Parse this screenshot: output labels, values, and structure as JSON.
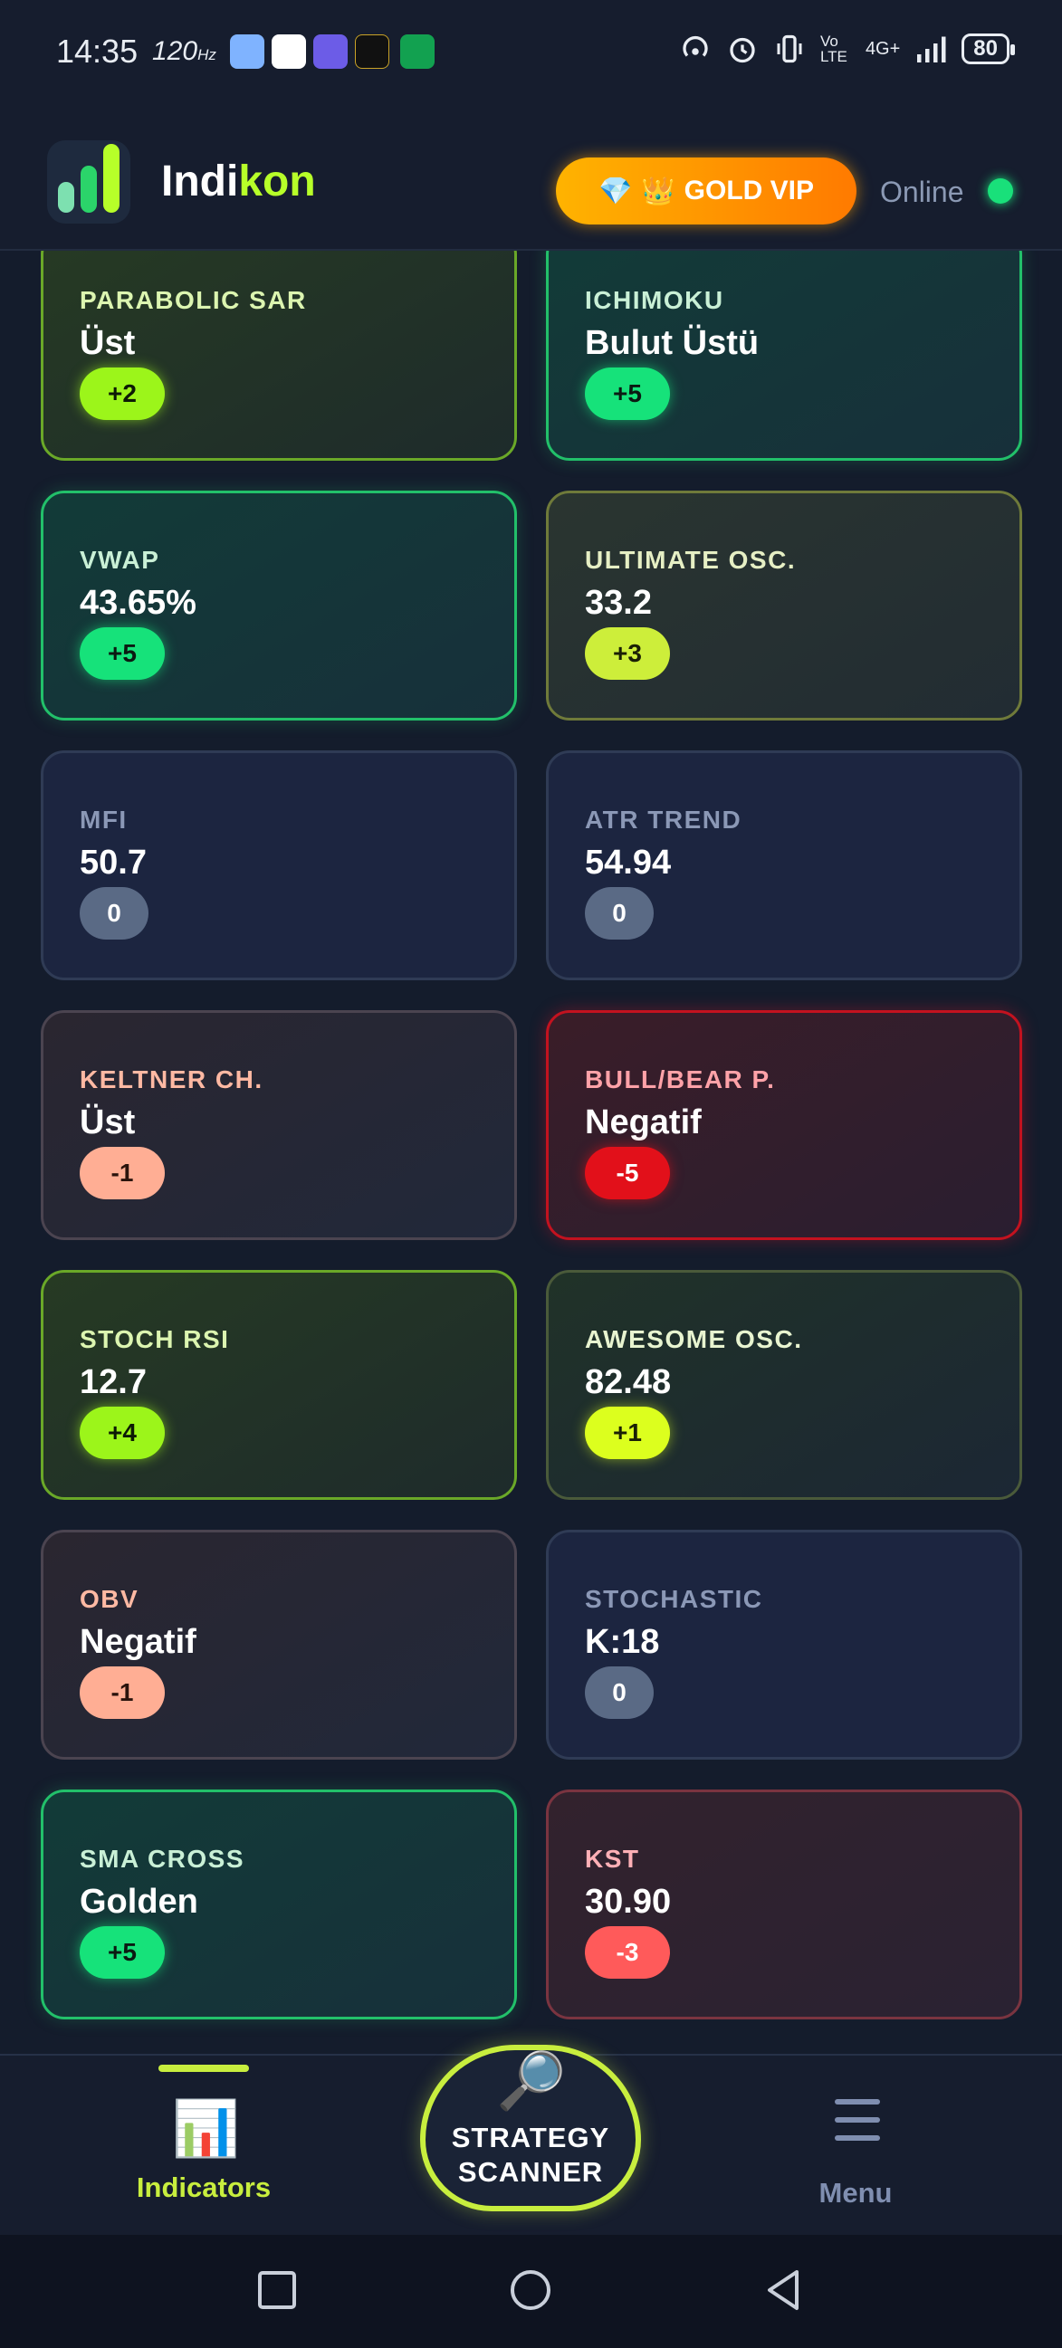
{
  "status_bar": {
    "time": "14:35",
    "refresh": "120",
    "refresh_unit": "Hz",
    "network": "4G+",
    "volte": "Vo LTE",
    "battery": "80"
  },
  "header": {
    "brand_part1": "Indi",
    "brand_part2": "kon",
    "vip_label": "GOLD VIP",
    "vip_icons": [
      "gem-icon",
      "crown-icon"
    ],
    "status_text": "Online",
    "status_color": "#19e07a"
  },
  "indicators": [
    {
      "label": "PARABOLIC SAR",
      "value": "Üst",
      "score": "+2",
      "tone": "lime"
    },
    {
      "label": "ICHIMOKU",
      "value": "Bulut Üstü",
      "score": "+5",
      "tone": "green"
    },
    {
      "label": "VWAP",
      "value": "43.65%",
      "score": "+5",
      "tone": "green"
    },
    {
      "label": "ULTIMATE OSC.",
      "value": "33.2",
      "score": "+3",
      "tone": "olive"
    },
    {
      "label": "MFI",
      "value": "50.7",
      "score": "0",
      "tone": "neutral"
    },
    {
      "label": "ATR TREND",
      "value": "54.94",
      "score": "0",
      "tone": "neutral"
    },
    {
      "label": "KELTNER CH.",
      "value": "Üst",
      "score": "-1",
      "tone": "salmon"
    },
    {
      "label": "BULL/BEAR P.",
      "value": "Negatif",
      "score": "-5",
      "tone": "red"
    },
    {
      "label": "STOCH RSI",
      "value": "12.7",
      "score": "+4",
      "tone": "lime"
    },
    {
      "label": "AWESOME OSC.",
      "value": "82.48",
      "score": "+1",
      "tone": "yellowgreen"
    },
    {
      "label": "OBV",
      "value": "Negatif",
      "score": "-1",
      "tone": "salmon"
    },
    {
      "label": "STOCHASTIC",
      "value": "K:18",
      "score": "0",
      "tone": "neutral"
    },
    {
      "label": "SMA CROSS",
      "value": "Golden",
      "score": "+5",
      "tone": "green"
    },
    {
      "label": "KST",
      "value": "30.90",
      "score": "-3",
      "tone": "rose"
    }
  ],
  "bottom_nav": {
    "indicators_label": "Indicators",
    "scanner_line1": "STRATEGY",
    "scanner_line2": "SCANNER",
    "menu_label": "Menu",
    "active": "Indicators",
    "accent": "#c8ee3e"
  }
}
